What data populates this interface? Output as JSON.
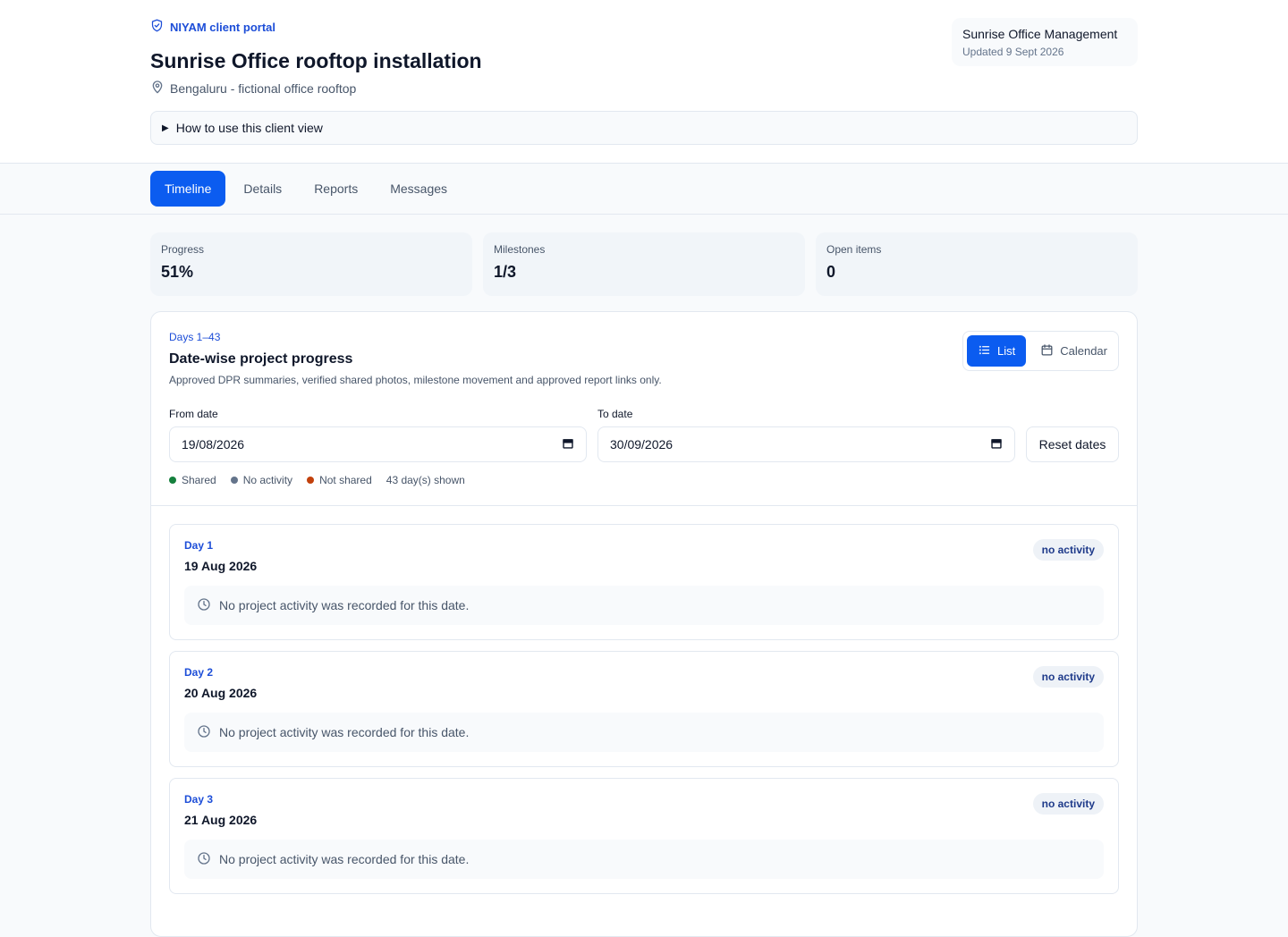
{
  "header": {
    "brand": "NIYAM client portal",
    "title": "Sunrise Office rooftop installation",
    "location": "Bengaluru - fictional office rooftop",
    "client_name": "Sunrise Office Management",
    "updated": "Updated 9 Sept 2026",
    "howto": "How to use this client view"
  },
  "tabs": [
    {
      "label": "Timeline",
      "active": true
    },
    {
      "label": "Details"
    },
    {
      "label": "Reports"
    },
    {
      "label": "Messages"
    }
  ],
  "stats": [
    {
      "label": "Progress",
      "value": "51%"
    },
    {
      "label": "Milestones",
      "value": "1/3"
    },
    {
      "label": "Open items",
      "value": "0"
    }
  ],
  "panel": {
    "kicker": "Days 1–43",
    "title": "Date-wise project progress",
    "description": "Approved DPR summaries, verified shared photos, milestone movement and approved report links only.",
    "view_list": "List",
    "view_calendar": "Calendar",
    "from_label": "From date",
    "from_value": "19/08/2026",
    "to_label": "To date",
    "to_value": "30/09/2026",
    "reset": "Reset dates",
    "legend": {
      "shared": "Shared",
      "no_activity": "No activity",
      "not_shared": "Not shared",
      "count": "43 day(s) shown"
    },
    "colors": {
      "shared": "#15803d",
      "no_activity": "#64748b",
      "not_shared": "#c2410c",
      "accent": "#0b5cf0"
    }
  },
  "days": [
    {
      "day": "Day 1",
      "date": "19 Aug 2026",
      "badge": "no activity",
      "message": "No project activity was recorded for this date."
    },
    {
      "day": "Day 2",
      "date": "20 Aug 2026",
      "badge": "no activity",
      "message": "No project activity was recorded for this date."
    },
    {
      "day": "Day 3",
      "date": "21 Aug 2026",
      "badge": "no activity",
      "message": "No project activity was recorded for this date."
    }
  ]
}
